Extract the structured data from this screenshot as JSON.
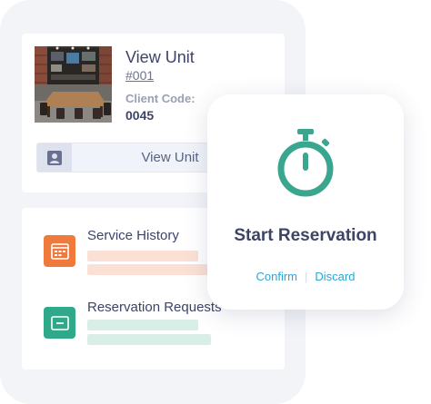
{
  "unit_card": {
    "title": "View Unit",
    "unit_id": "#001",
    "client_code_label": "Client Code:",
    "client_code_value": "0045",
    "photo_icon": "office-interior-photo",
    "view_button": {
      "icon": "user-card-icon",
      "label": "View Unit"
    }
  },
  "list_card": {
    "items": [
      {
        "title": "Service History",
        "icon": "calendar-icon",
        "color": "#f07a3c",
        "bar_color": "#fbe0d5"
      },
      {
        "title": "Reservation Requests",
        "icon": "card-icon",
        "color": "#2fa98a",
        "bar_color": "#d9eee6"
      }
    ]
  },
  "popup": {
    "icon": "stopwatch-icon",
    "icon_color": "#3aa68f",
    "title": "Start Reservation",
    "confirm_label": "Confirm",
    "discard_label": "Discard",
    "link_color": "#27a8d6"
  }
}
